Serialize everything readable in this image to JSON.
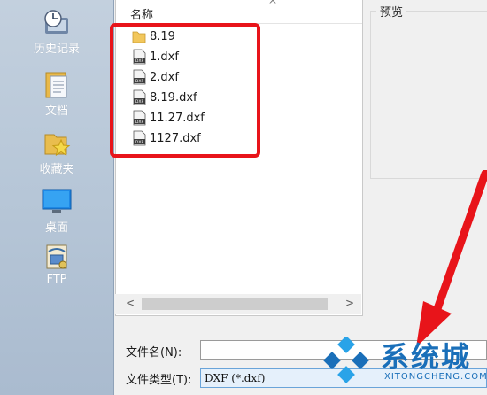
{
  "places": [
    {
      "label": "历史记录",
      "icon": "history-clock-icon"
    },
    {
      "label": "文档",
      "icon": "documents-icon"
    },
    {
      "label": "收藏夹",
      "icon": "favorites-star-folder-icon"
    },
    {
      "label": "桌面",
      "icon": "desktop-monitor-icon"
    },
    {
      "label": "FTP",
      "icon": "ftp-icon"
    }
  ],
  "filelist": {
    "column_name": "名称",
    "sort_arrow": "^",
    "items": [
      {
        "name": "8.19",
        "icon": "folder-icon"
      },
      {
        "name": "1.dxf",
        "icon": "dxf-file-icon"
      },
      {
        "name": "2.dxf",
        "icon": "dxf-file-icon"
      },
      {
        "name": "8.19.dxf",
        "icon": "dxf-file-icon"
      },
      {
        "name": "11.27.dxf",
        "icon": "dxf-file-icon"
      },
      {
        "name": "1127.dxf",
        "icon": "dxf-file-icon"
      }
    ]
  },
  "scrollbar": {
    "left": "<",
    "right": ">"
  },
  "preview": {
    "label": "预览"
  },
  "filename": {
    "label": "文件名(N):",
    "value": ""
  },
  "filetype": {
    "label": "文件类型(T):",
    "value": "DXF (*.dxf)"
  },
  "dxf_badge": "DXF",
  "watermark": {
    "text_cn": "系统城",
    "text_en": "XITONGCHENG.COM"
  },
  "colors": {
    "highlight_box": "#e8141a",
    "arrow": "#e8141a",
    "watermark": "#1a6fb9",
    "places_bg": "#b6c6d7"
  }
}
